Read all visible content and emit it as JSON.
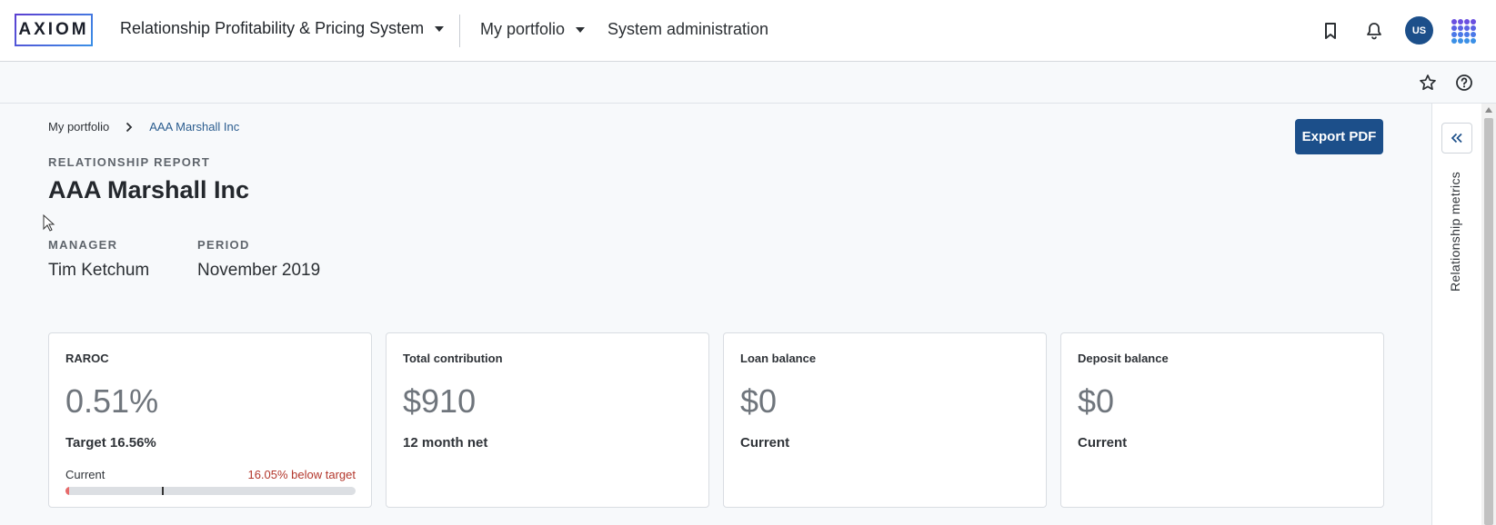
{
  "header": {
    "logo_text": "AXIOM",
    "app_name": "Relationship Profitability & Pricing System",
    "nav": {
      "portfolio": "My portfolio",
      "admin": "System administration"
    },
    "user_initials": "US",
    "icons": [
      "bookmark-icon",
      "bell-icon",
      "apps-grid-icon"
    ]
  },
  "subbar": {
    "icons": [
      "star-icon",
      "help-icon"
    ]
  },
  "breadcrumb": {
    "parent": "My portfolio",
    "current": "AAA Marshall Inc"
  },
  "toolbar": {
    "export_label": "Export PDF"
  },
  "report": {
    "eyebrow": "RELATIONSHIP REPORT",
    "title": "AAA Marshall Inc",
    "manager_label": "MANAGER",
    "manager": "Tim Ketchum",
    "period_label": "PERIOD",
    "period": "November 2019"
  },
  "cards": [
    {
      "label": "RAROC",
      "value": "0.51%",
      "sub": "Target 16.56%",
      "bar_label": "Current",
      "bar_note": "16.05% below target",
      "current_fraction": 0.0051,
      "target_fraction": 0.3312
    },
    {
      "label": "Total contribution",
      "value": "$910",
      "sub": "12 month net"
    },
    {
      "label": "Loan balance",
      "value": "$0",
      "sub": "Current"
    },
    {
      "label": "Deposit balance",
      "value": "$0",
      "sub": "Current"
    }
  ],
  "rail": {
    "label": "Relationship metrics"
  },
  "colors": {
    "primary": "#1c4f8a",
    "danger": "#b3372c",
    "accent_purple": "#5b3fd1"
  }
}
